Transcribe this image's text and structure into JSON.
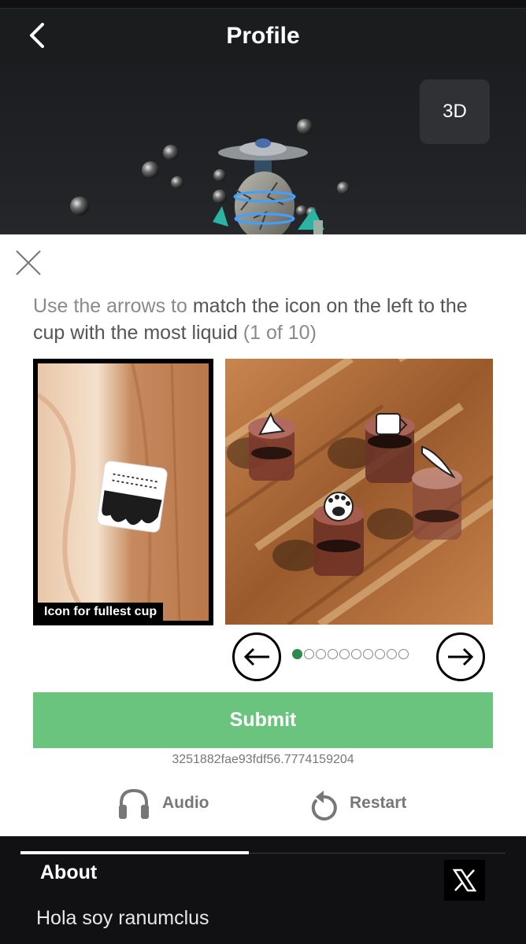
{
  "header": {
    "title": "Profile",
    "back_icon": "chevron-left-icon"
  },
  "avatar": {
    "view_3d_label": "3D"
  },
  "captcha": {
    "close_icon": "close-icon",
    "instruction_prefix": "Use the arrows to ",
    "instruction_bold": "match the icon on the left to the cup with the most liquid",
    "instruction_suffix": " (1 of 10)",
    "left_caption": "Icon for fullest cup",
    "current_page": 1,
    "total_pages": 10,
    "submit_label": "Submit",
    "session_id": "3251882fae93fdf56.7774159204",
    "audio_label": "Audio",
    "restart_label": "Restart",
    "accent_color": "#6ac47e",
    "active_dot_color": "#2e8a4b"
  },
  "footer": {
    "about_label": "About",
    "social_icon": "x-logo-icon",
    "bio": "Hola soy ranumclus"
  }
}
